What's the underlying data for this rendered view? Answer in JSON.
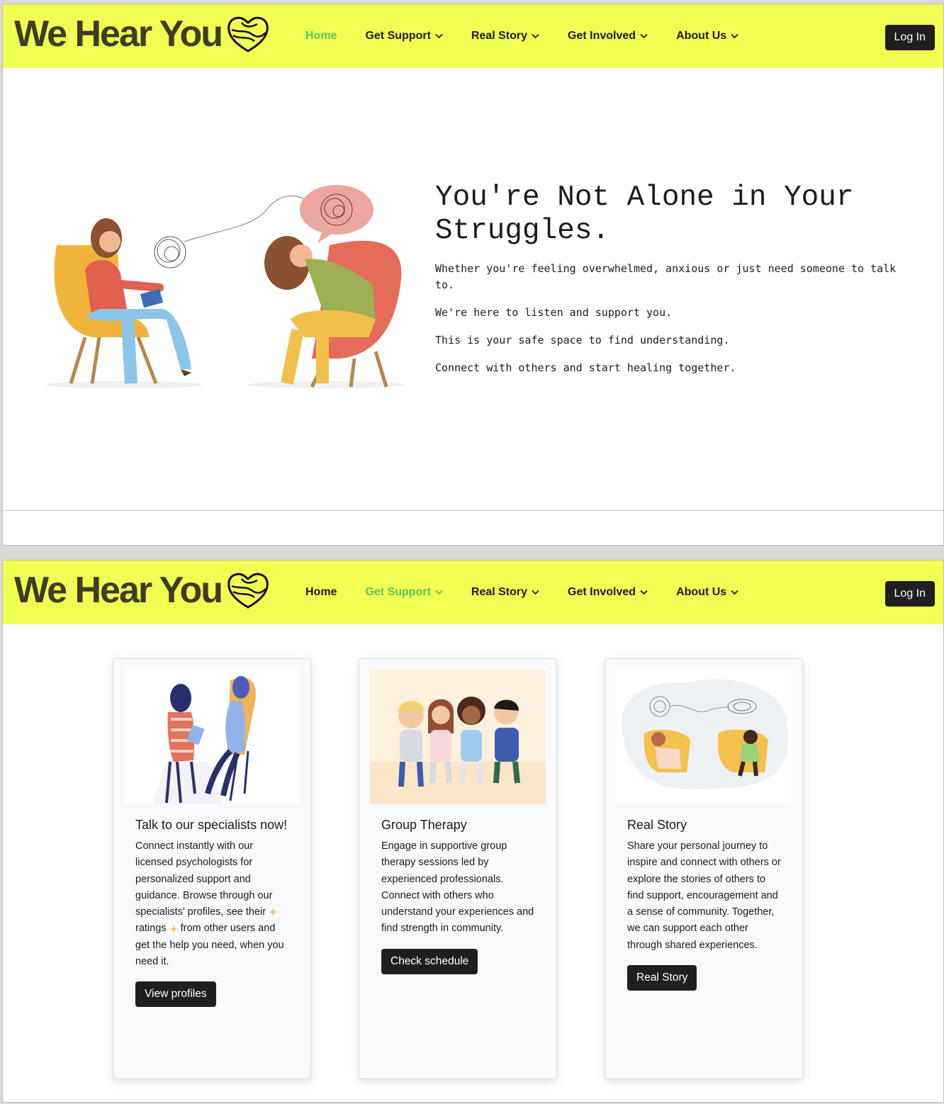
{
  "brand": {
    "name": "We Hear You",
    "logo_icon": "heart-hands-icon"
  },
  "nav": {
    "home": "Home",
    "get_support": "Get Support",
    "real_story": "Real Story",
    "get_involved": "Get Involved",
    "about_us": "About Us",
    "login": "Log In",
    "active_color": "#5cc45c",
    "bar_color": "#f0ff52"
  },
  "screen1": {
    "active_nav": "Home"
  },
  "screen2": {
    "active_nav": "Get Support"
  },
  "hero": {
    "title_line1": "You're Not Alone in Your",
    "title_line2": "Struggles.",
    "p1": "Whether you're feeling overwhelmed, anxious or just need someone to talk to.",
    "p2": "We're here to listen and support you.",
    "p3": "This is your safe space to find understanding.",
    "p4": "Connect with others and start healing together."
  },
  "cards": [
    {
      "title": "Talk to our specialists now!",
      "text_before": "Connect instantly with our licensed psychologists for personalized support and guidance. Browse through our specialists' profiles, see their",
      "text_middle": "ratings",
      "text_after": "from other users and get the help you need, when you need it.",
      "button": "View profiles"
    },
    {
      "title": "Group Therapy",
      "text": "Engage in supportive group therapy sessions led by experienced professionals. Connect with others who understand your experiences and find strength in community.",
      "button": "Check schedule"
    },
    {
      "title": "Real Story",
      "text": "Share your personal journey to inspire and connect with others or explore the stories of others to find support, encouragement and a sense of community. Together, we can support each other through shared experiences.",
      "button": "Real Story"
    }
  ]
}
